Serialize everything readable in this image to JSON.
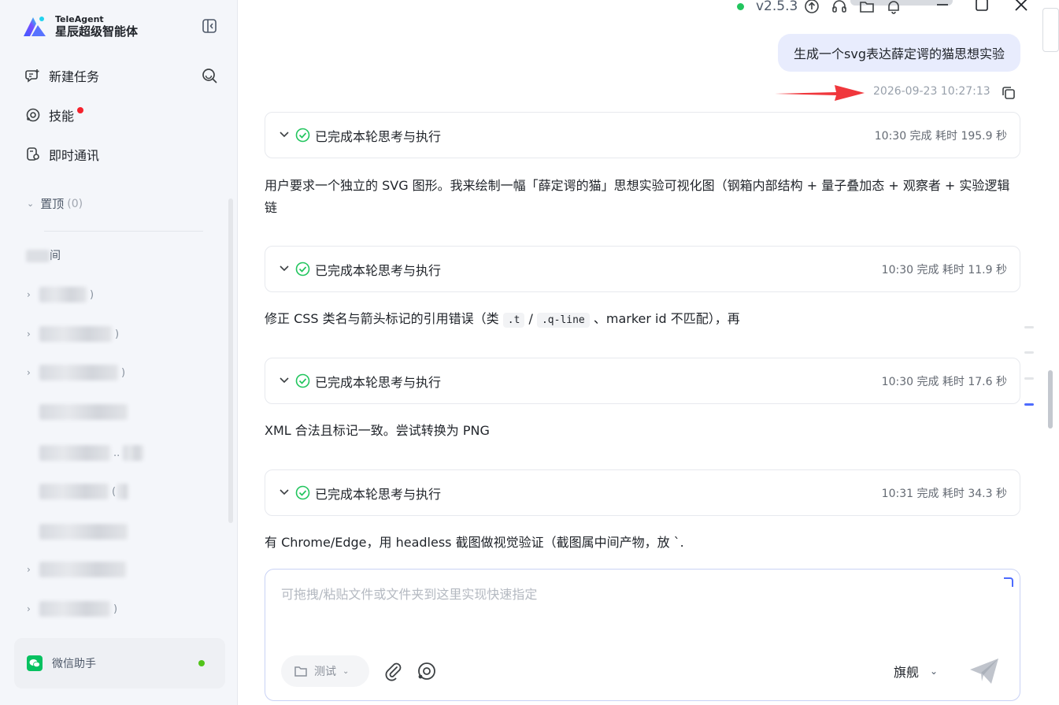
{
  "app": {
    "brand_en": "TeleAgent",
    "brand_zh": "星辰超级智能体",
    "version": "v2.5.3"
  },
  "sidebar": {
    "nav": [
      {
        "label": "新建任务",
        "icon": "new-task-icon"
      },
      {
        "label": "技能",
        "icon": "skill-icon",
        "badge": "red-dot"
      },
      {
        "label": "即时通讯",
        "icon": "im-icon"
      }
    ],
    "pinned": {
      "label": "置顶",
      "count": "(0)"
    },
    "workspace_label": "间",
    "rows": [
      {
        "tail": ")"
      },
      {
        "tail": ")"
      },
      {
        "tail": ")"
      },
      {
        "tail": ""
      },
      {
        "tail": ".."
      },
      {
        "tail": "("
      },
      {
        "tail": ""
      },
      {
        "tail": ""
      },
      {
        "tail": ")"
      }
    ],
    "wechat": {
      "label": "微信助手",
      "status_color": "#52c41a"
    }
  },
  "chat": {
    "user_message": "生成一个svg表达薛定谔的猫思想实验",
    "user_message_time": "2026-09-23 10:27:13",
    "rounds": [
      {
        "title": "已完成本轮思考与执行",
        "meta": "10:30 完成 耗时 195.9 秒",
        "text": "用户要求一个独立的 SVG 图形。我来绘制一幅「薛定谔的猫」思想实验可视化图（钢箱内部结构 + 量子叠加态 + 观察者 + 实验逻辑链"
      },
      {
        "title": "已完成本轮思考与执行",
        "meta": "10:30 完成 耗时 11.9 秒",
        "text_parts": {
          "before": "修正 CSS 类名与箭头标记的引用错误（类 ",
          "code1": ".t",
          "sep": " / ",
          "code2": ".q-line",
          "after": " 、marker id 不匹配），再"
        }
      },
      {
        "title": "已完成本轮思考与执行",
        "meta": "10:30 完成 耗时 17.6 秒",
        "text": "XML 合法且标记一致。尝试转换为 PNG"
      },
      {
        "title": "已完成本轮思考与执行",
        "meta": "10:31 完成 耗时 34.3 秒",
        "text": "有 Chrome/Edge，用 headless 截图做视觉验证（截图属中间产物，放 `."
      }
    ]
  },
  "input": {
    "placeholder": "可拖拽/粘贴文件或文件夹到这里实现快速指定",
    "folder_chip": "测试",
    "model": "旗舰"
  },
  "colors": {
    "accent": "#4d6bfe",
    "success": "#22c55e",
    "bubble": "#e8ecfd",
    "sidebar_bg": "#f4f6fa",
    "annotation_arrow": "#f0373c"
  }
}
